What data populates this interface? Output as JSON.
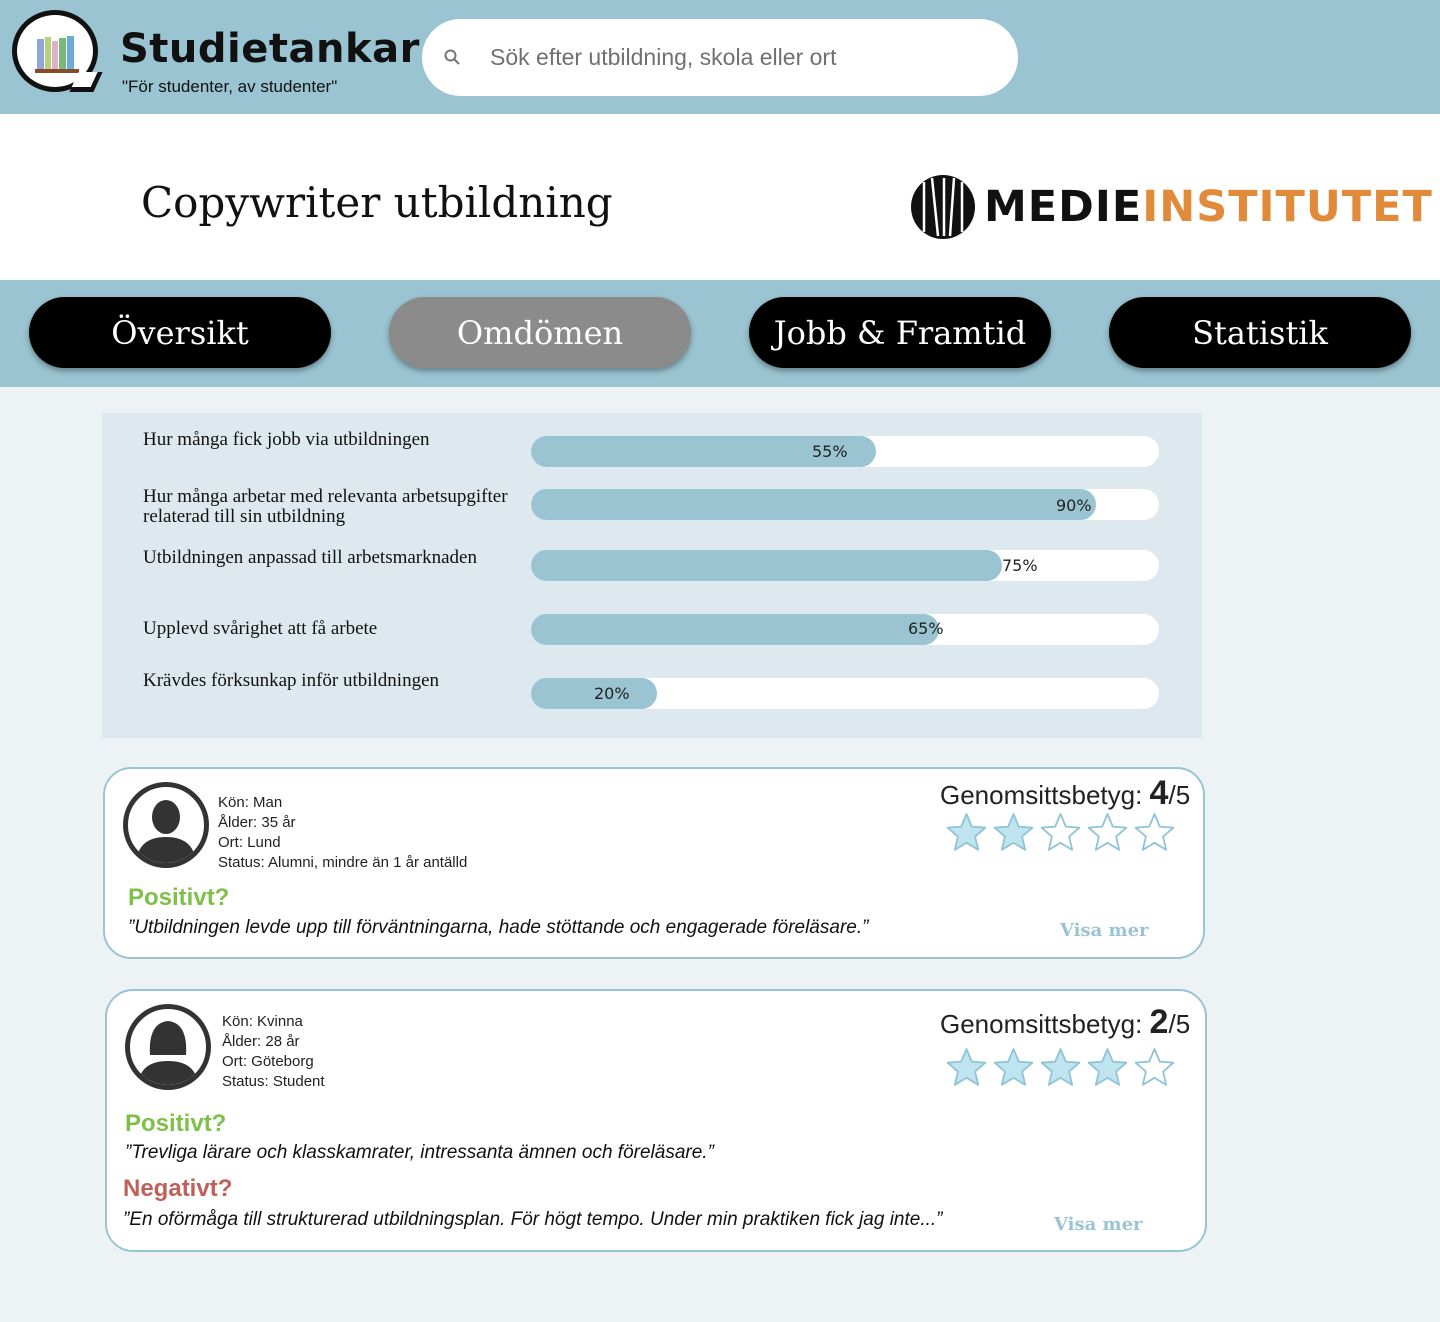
{
  "header": {
    "brand": "Studietankar",
    "tagline": "\"För studenter, av studenter\"",
    "search_placeholder": "Sök efter utbildning, skola eller ort"
  },
  "course": {
    "title": "Copywriter utbildning",
    "institute_part1": "MEDIE",
    "institute_part2": "INSTITUTET",
    "institute_color": "#e08a3a"
  },
  "tabs": [
    {
      "label": "Översikt",
      "active": false
    },
    {
      "label": "Omdömen",
      "active": true
    },
    {
      "label": "Jobb & Framtid",
      "active": false
    },
    {
      "label": "Statistik",
      "active": false
    }
  ],
  "stats": [
    {
      "label": "Hur många fick jobb via utbildningen",
      "value": 55,
      "pct_text": "55%"
    },
    {
      "label": "Hur många arbetar med relevanta arbetsupgifter relaterad till sin utbildning",
      "value": 90,
      "pct_text": "90%"
    },
    {
      "label": "Utbildningen anpassad till arbetsmarknaden",
      "value": 75,
      "pct_text": "75%"
    },
    {
      "label": "Upplevd svårighet att få arbete",
      "value": 65,
      "pct_text": "65%"
    },
    {
      "label": "Krävdes förksunkap inför utbildningen",
      "value": 20,
      "pct_text": "20%"
    }
  ],
  "reviews": [
    {
      "gender": "Kön: Man",
      "age": "Ålder: 35 år",
      "city": "Ort: Lund",
      "status": "Status: Alumni, mindre än 1 år antälld",
      "rating_label": "Genomsittsbetyg:",
      "rating": "4",
      "rating_max": "/5",
      "stars_filled": 2,
      "positive_title": "Positivt?",
      "positive_text": "”Utbildningen levde upp till förväntningarna, hade stöttande och engagerade föreläsare.”",
      "more": "Visa mer"
    },
    {
      "gender": "Kön: Kvinna",
      "age": "Ålder: 28 år",
      "city": "Ort: Göteborg",
      "status": "Status: Student",
      "rating_label": "Genomsittsbetyg:",
      "rating": "2",
      "rating_max": "/5",
      "stars_filled": 4,
      "positive_title": "Positivt?",
      "positive_text": "”Trevliga lärare och klasskamrater, intressanta ämnen och föreläsare.”",
      "negative_title": "Negativt?",
      "negative_text": "”En oförmåga till strukturerad utbildningsplan. För högt tempo. Under min praktiken fick jag inte...”",
      "more": "Visa mer"
    }
  ],
  "colors": {
    "band": "#9ac4d2",
    "positive": "#7ec04a",
    "negative": "#c0605a",
    "star_fill": "#bfe3ef"
  }
}
